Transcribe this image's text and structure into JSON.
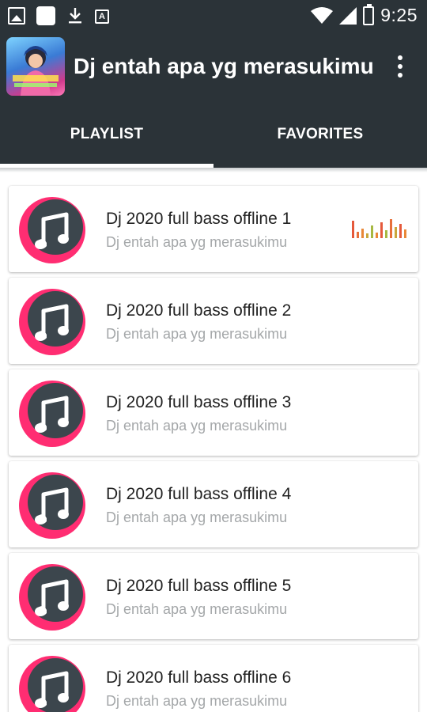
{
  "status_bar": {
    "time": "9:25",
    "icons": [
      "image-icon",
      "square-icon",
      "download-icon",
      "a-icon",
      "wifi-icon",
      "signal-icon",
      "battery-icon"
    ]
  },
  "app_bar": {
    "title": "Dj entah apa yg merasukimu",
    "overflow_icon": "more-vert-icon"
  },
  "tabs": [
    {
      "label": "PLAYLIST",
      "selected": true
    },
    {
      "label": "FAVORITES",
      "selected": false
    }
  ],
  "playlist": [
    {
      "title": "Dj 2020 full bass offline 1",
      "subtitle": "Dj entah apa yg merasukimu",
      "playing": true
    },
    {
      "title": "Dj 2020 full bass offline 2",
      "subtitle": "Dj entah apa yg merasukimu",
      "playing": false
    },
    {
      "title": "Dj 2020 full bass offline 3",
      "subtitle": "Dj entah apa yg merasukimu",
      "playing": false
    },
    {
      "title": "Dj 2020 full bass offline 4",
      "subtitle": "Dj entah apa yg merasukimu",
      "playing": false
    },
    {
      "title": "Dj 2020 full bass offline 5",
      "subtitle": "Dj entah apa yg merasukimu",
      "playing": false
    },
    {
      "title": "Dj 2020 full bass offline 6",
      "subtitle": "Dj entah apa yg merasukimu",
      "playing": false
    }
  ],
  "colors": {
    "toolbar": "#2b3338",
    "accent": "#ff2d72",
    "icon_disc": "#3c464d",
    "subtitle": "#a4a7a9"
  }
}
